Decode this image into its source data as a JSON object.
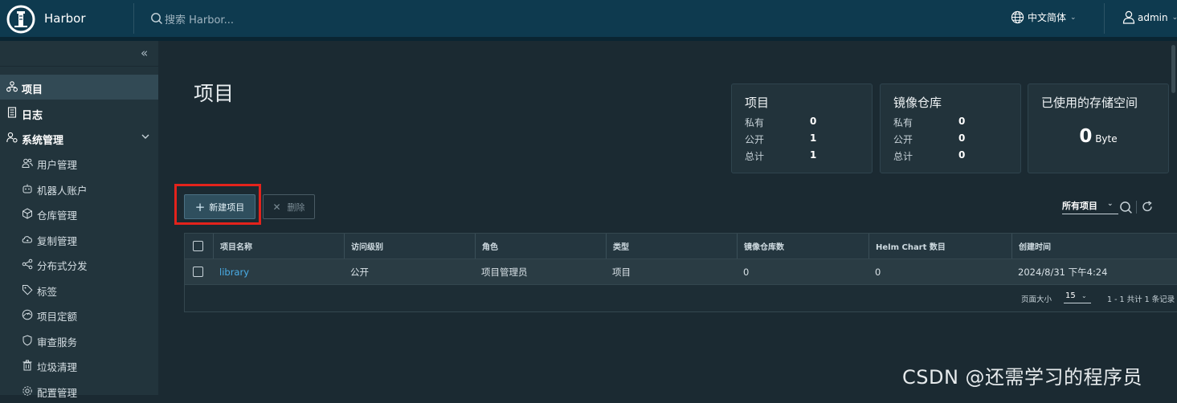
{
  "header": {
    "brand": "Harbor",
    "search_placeholder": "搜索 Harbor...",
    "language": "中文简体",
    "user": "admin"
  },
  "sidebar": {
    "items": [
      {
        "label": "项目",
        "icon": "projects-icon"
      },
      {
        "label": "日志",
        "icon": "logs-icon"
      },
      {
        "label": "系统管理",
        "icon": "admin-icon"
      }
    ],
    "subitems": [
      {
        "label": "用户管理",
        "icon": "users-icon"
      },
      {
        "label": "机器人账户",
        "icon": "robot-icon"
      },
      {
        "label": "仓库管理",
        "icon": "registry-icon"
      },
      {
        "label": "复制管理",
        "icon": "replication-icon"
      },
      {
        "label": "分布式分发",
        "icon": "share-icon"
      },
      {
        "label": "标签",
        "icon": "tag-icon"
      },
      {
        "label": "项目定额",
        "icon": "quota-icon"
      },
      {
        "label": "审查服务",
        "icon": "shield-icon"
      },
      {
        "label": "垃圾清理",
        "icon": "trash-icon"
      },
      {
        "label": "配置管理",
        "icon": "gear-icon"
      }
    ]
  },
  "main": {
    "title": "项目",
    "cards": {
      "projects": {
        "title": "项目",
        "rows": [
          {
            "k": "私有",
            "v": "0"
          },
          {
            "k": "公开",
            "v": "1"
          },
          {
            "k": "总计",
            "v": "1"
          }
        ]
      },
      "repos": {
        "title": "镜像仓库",
        "rows": [
          {
            "k": "私有",
            "v": "0"
          },
          {
            "k": "公开",
            "v": "0"
          },
          {
            "k": "总计",
            "v": "0"
          }
        ]
      },
      "storage": {
        "title": "已使用的存储空间",
        "value": "0",
        "unit": "Byte"
      }
    },
    "toolbar": {
      "new_project": "新建项目",
      "delete": "删除",
      "filter": "所有项目"
    },
    "table": {
      "columns": [
        "项目名称",
        "访问级别",
        "角色",
        "类型",
        "镜像仓库数",
        "Helm Chart 数目",
        "创建时间"
      ],
      "rows": [
        [
          "library",
          "公开",
          "项目管理员",
          "项目",
          "0",
          "0",
          "2024/8/31 下午4:24"
        ]
      ],
      "page_size_label": "页面大小",
      "page_size": "15",
      "total": "1 - 1 共计 1 条记录"
    }
  },
  "watermark": "CSDN @还需学习的程序员"
}
